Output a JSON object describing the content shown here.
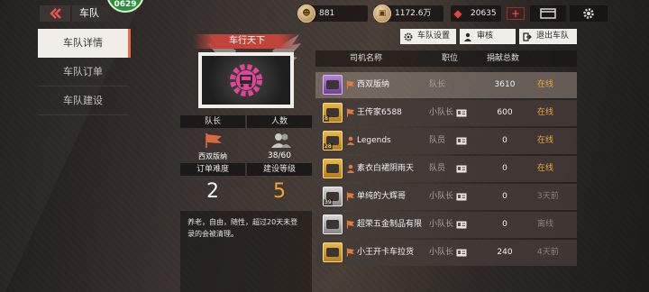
{
  "header": {
    "title": "车队",
    "level": "0629",
    "resources": {
      "coins": "881",
      "cash": "1172.6万",
      "gems": "20635"
    },
    "plus": "+",
    "coin_glyphs": {
      "coins": "☻",
      "cash": "▣",
      "gems": "◆"
    }
  },
  "sidebar": {
    "items": [
      {
        "label": "车队详情",
        "active": true
      },
      {
        "label": "车队订单",
        "active": false
      },
      {
        "label": "车队建设",
        "active": false
      }
    ]
  },
  "team": {
    "name": "车行天下",
    "captain_label": "队长",
    "members_label": "人数",
    "captain_name": "西双版纳",
    "members_value": "38/60",
    "difficulty_label": "订单难度",
    "build_level_label": "建设等级",
    "difficulty_value": "2",
    "build_level_value": "5",
    "notice": "养老，自由，随性，超过20天未登录的会被清理。",
    "accent_color": "#f4a23c",
    "emblem_color": "#e0459a"
  },
  "actions": {
    "settings": "车队设置",
    "review": "审核",
    "quit": "退出车队"
  },
  "table": {
    "headers": {
      "name": "司机名称",
      "role": "职位",
      "donation": "捐献总数"
    },
    "rows": [
      {
        "name": "西双版纳",
        "role": "队长",
        "donation": "3610",
        "status": "在线",
        "online": true,
        "avatar": "purple",
        "level": "",
        "name_icon": "flag"
      },
      {
        "name": "王传家6588",
        "role": "小队长",
        "donation": "600",
        "status": "在线",
        "online": true,
        "avatar": "gold",
        "level": "8",
        "name_icon": "flag"
      },
      {
        "name": "Legends",
        "role": "队员",
        "donation": "0",
        "status": "在线",
        "online": true,
        "avatar": "gold",
        "level": "28",
        "name_icon": "person"
      },
      {
        "name": "素衣白裙阴雨天",
        "role": "队员",
        "donation": "0",
        "status": "在线",
        "online": true,
        "avatar": "gold",
        "level": "",
        "name_icon": "person"
      },
      {
        "name": "单纯的大辉哥",
        "role": "小队长",
        "donation": "0",
        "status": "3天前",
        "online": false,
        "avatar": "silver",
        "level": "39",
        "name_icon": "flag"
      },
      {
        "name": "超荣五金制品有限",
        "role": "小队长",
        "donation": "0",
        "status": "离线",
        "online": false,
        "avatar": "silver",
        "level": "",
        "name_icon": "flag"
      },
      {
        "name": "小王开卡车拉货",
        "role": "小队长",
        "donation": "240",
        "status": "4天前",
        "online": false,
        "avatar": "gold",
        "level": "",
        "name_icon": "flag"
      }
    ]
  }
}
